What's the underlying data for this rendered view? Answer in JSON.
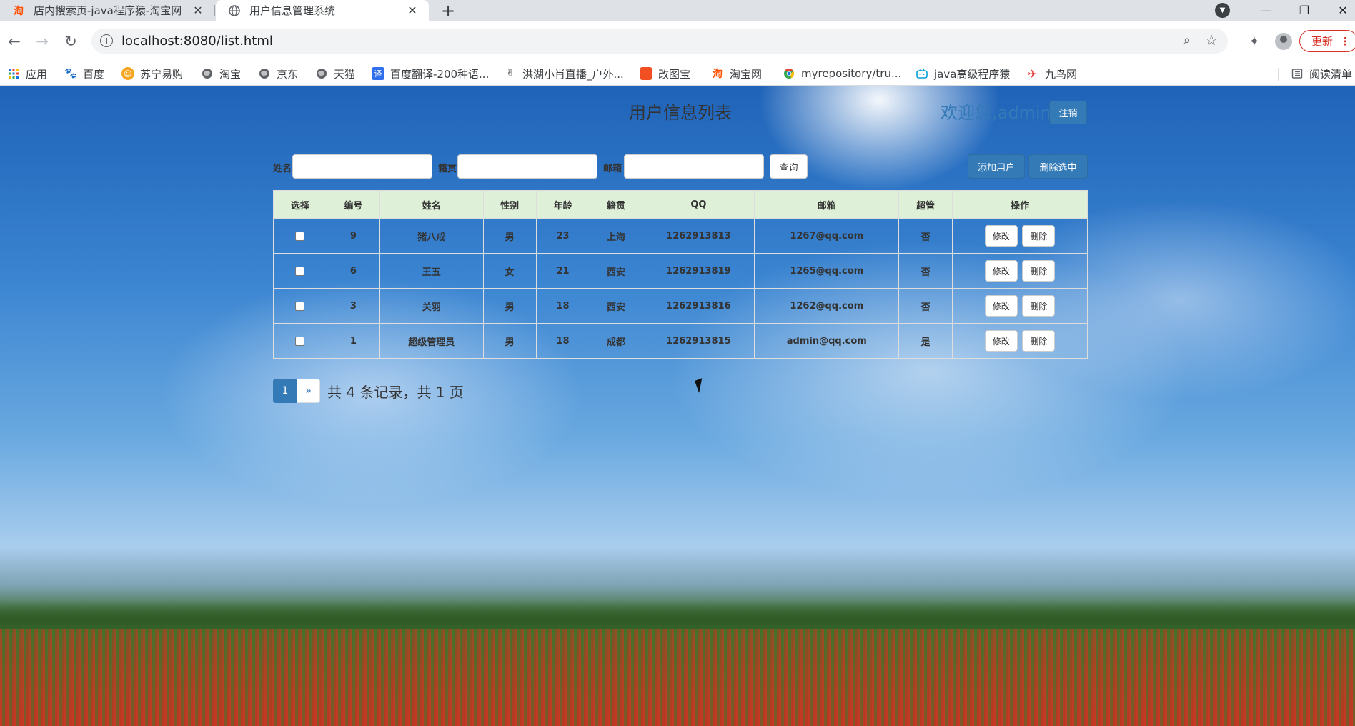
{
  "browser": {
    "tabs": [
      {
        "title": "店内搜索页-java程序猿-淘宝网",
        "favicon": "taobao-icon",
        "active": false
      },
      {
        "title": "用户信息管理系统",
        "favicon": "globe-icon",
        "active": true
      }
    ],
    "new_tab": "+",
    "address": "localhost:8080/list.html",
    "update_label": "更新",
    "bookmarks": [
      {
        "label": "应用",
        "icon": "apps-grid-icon",
        "color": "#4285f4"
      },
      {
        "label": "百度",
        "icon": "baidu-paw-icon",
        "color": "#2932e1"
      },
      {
        "label": "苏宁易购",
        "icon": "suning-lion-icon",
        "color": "#f5a623"
      },
      {
        "label": "淘宝",
        "icon": "globe-icon",
        "color": "#5f6368"
      },
      {
        "label": "京东",
        "icon": "globe-icon",
        "color": "#5f6368"
      },
      {
        "label": "天猫",
        "icon": "globe-icon",
        "color": "#5f6368"
      },
      {
        "label": "百度翻译-200种语...",
        "icon": "translate-icon",
        "color": "#2f6fed"
      },
      {
        "label": "洪湖小肖直播_户外...",
        "icon": "broadcast-icon",
        "color": "#5f6368"
      },
      {
        "label": "改图宝",
        "icon": "gaitubao-icon",
        "color": "#f25022"
      },
      {
        "label": "淘宝网",
        "icon": "taobao-icon",
        "color": "#ff5000"
      },
      {
        "label": "myrepository/tru...",
        "icon": "chrome-icon",
        "color": "#34a853"
      },
      {
        "label": "java高级程序猿",
        "icon": "bilibili-icon",
        "color": "#00a1d6"
      },
      {
        "label": "九鸟网",
        "icon": "bird-icon",
        "color": "#e53935"
      }
    ],
    "reading_list": "阅读清单"
  },
  "page": {
    "title": "用户信息列表",
    "welcome": "欢迎您,admin",
    "logout_label": "注销",
    "search": {
      "name_label": "姓名",
      "native_label": "籍贯",
      "email_label": "邮箱",
      "name_value": "",
      "native_value": "",
      "email_value": "",
      "query_label": "查询"
    },
    "add_label": "添加用户",
    "delete_selected_label": "删除选中",
    "table": {
      "headers": [
        "选择",
        "编号",
        "姓名",
        "性别",
        "年龄",
        "籍贯",
        "QQ",
        "邮箱",
        "超管",
        "操作"
      ],
      "rows": [
        {
          "id": "9",
          "name": "猪八戒",
          "gender": "男",
          "age": "23",
          "native": "上海",
          "qq": "1262913813",
          "email": "1267@qq.com",
          "admin": "否"
        },
        {
          "id": "6",
          "name": "王五",
          "gender": "女",
          "age": "21",
          "native": "西安",
          "qq": "1262913819",
          "email": "1265@qq.com",
          "admin": "否"
        },
        {
          "id": "3",
          "name": "关羽",
          "gender": "男",
          "age": "18",
          "native": "西安",
          "qq": "1262913816",
          "email": "1262@qq.com",
          "admin": "否"
        },
        {
          "id": "1",
          "name": "超级管理员",
          "gender": "男",
          "age": "18",
          "native": "成都",
          "qq": "1262913815",
          "email": "admin@qq.com",
          "admin": "是"
        }
      ],
      "edit_label": "修改",
      "delete_label": "删除"
    },
    "pagination": {
      "current": "1",
      "next": "»",
      "info": "共 4 条记录，共 1 页"
    }
  },
  "colors": {
    "primary": "#337ab7",
    "header_bg": "#dff0d8"
  }
}
